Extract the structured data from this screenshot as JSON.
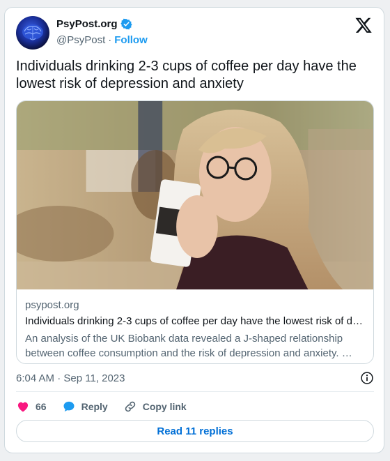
{
  "header": {
    "display_name": "PsyPost.org",
    "handle": "@PsyPost",
    "separator": "·",
    "follow_label": "Follow",
    "avatar_icon": "brain-icon",
    "verified_icon": "verified-badge-icon",
    "platform_icon": "x-logo-icon"
  },
  "tweet": {
    "text": "Individuals drinking 2-3 cups of coffee per day have the lowest risk of depression and anxiety"
  },
  "link_card": {
    "domain": "psypost.org",
    "title": "Individuals drinking 2-3 cups of coffee per day have the lowest risk of d…",
    "description": "An analysis of the UK Biobank data revealed a J-shaped relationship between coffee consumption and the risk of depression and anxiety. …"
  },
  "meta": {
    "timestamp": "6:04 AM · Sep 11, 2023",
    "info_icon": "info-icon"
  },
  "actions": {
    "like_count": "66",
    "reply_label": "Reply",
    "copy_link_label": "Copy link"
  },
  "footer": {
    "read_replies_label": "Read 11 replies"
  },
  "colors": {
    "brand_blue": "#1d9bf0",
    "like_pink": "#f91880",
    "text_secondary": "#536471",
    "link_blue": "#006fd6"
  }
}
